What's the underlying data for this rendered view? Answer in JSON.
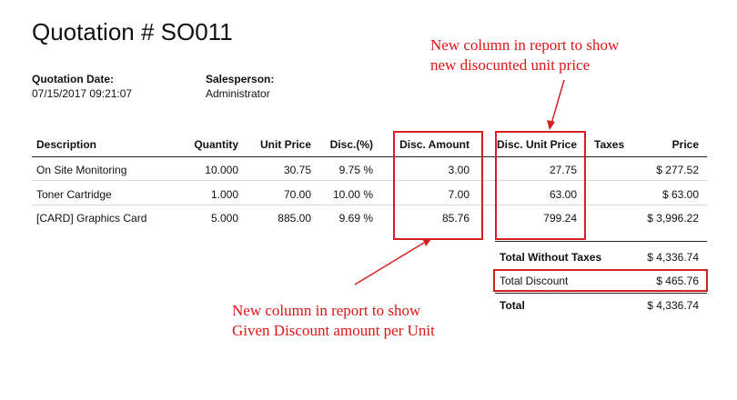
{
  "document": {
    "title": "Quotation # SO011",
    "date_label": "Quotation Date:",
    "date_value": "07/15/2017 09:21:07",
    "salesperson_label": "Salesperson:",
    "salesperson_value": "Administrator"
  },
  "table": {
    "headers": {
      "description": "Description",
      "quantity": "Quantity",
      "unit_price": "Unit Price",
      "disc_pct": "Disc.(%)",
      "disc_amount": "Disc. Amount",
      "disc_unit_price": "Disc. Unit Price",
      "taxes": "Taxes",
      "price": "Price"
    },
    "rows": [
      {
        "description": "On Site Monitoring",
        "quantity": "10.000",
        "unit_price": "30.75",
        "disc_pct": "9.75 %",
        "disc_amount": "3.00",
        "disc_unit_price": "27.75",
        "taxes": "",
        "price": "$ 277.52"
      },
      {
        "description": "Toner Cartridge",
        "quantity": "1.000",
        "unit_price": "70.00",
        "disc_pct": "10.00 %",
        "disc_amount": "7.00",
        "disc_unit_price": "63.00",
        "taxes": "",
        "price": "$ 63.00"
      },
      {
        "description": "[CARD] Graphics Card",
        "quantity": "5.000",
        "unit_price": "885.00",
        "disc_pct": "9.69 %",
        "disc_amount": "85.76",
        "disc_unit_price": "799.24",
        "taxes": "",
        "price": "$ 3,996.22"
      }
    ]
  },
  "totals": {
    "without_taxes_label": "Total Without Taxes",
    "without_taxes_value": "$ 4,336.74",
    "discount_label": "Total Discount",
    "discount_value": "$ 465.76",
    "total_label": "Total",
    "total_value": "$ 4,336.74"
  },
  "annotations": {
    "top_line1": "New column in report to show",
    "top_line2": "new disocunted unit price",
    "bottom_line1": "New column in report to show",
    "bottom_line2": "Given Discount amount per Unit"
  },
  "colors": {
    "annotation": "#e01515",
    "highlight_box": "#d42020"
  }
}
